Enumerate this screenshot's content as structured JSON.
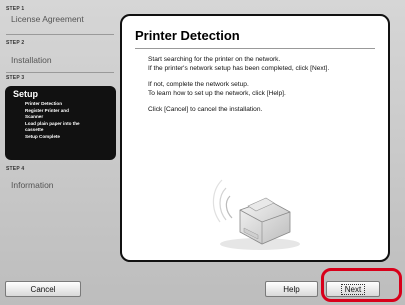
{
  "sidebar": {
    "steps": [
      {
        "step": "STEP 1",
        "name": "License Agreement"
      },
      {
        "step": "STEP 2",
        "name": "Installation"
      },
      {
        "step": "STEP 3",
        "name": "Setup"
      },
      {
        "step": "STEP 4",
        "name": "Information"
      }
    ],
    "setup_items": [
      "Printer Detection",
      "Register Printer and",
      "Scanner",
      "Load plain paper into the",
      "cassette",
      "Setup Complete"
    ]
  },
  "main": {
    "title": "Printer Detection",
    "paragraphs": [
      [
        "Start searching for the printer on the network.",
        "If the printer's network setup has been completed, click [Next]."
      ],
      [
        "If not, complete the network setup.",
        "To learn how to set up the network, click [Help]."
      ],
      [
        "Click [Cancel] to cancel the installation."
      ]
    ],
    "illustration": "printer-illustration"
  },
  "buttons": {
    "cancel": "Cancel",
    "help": "Help",
    "next": "Next"
  },
  "colors": {
    "highlight": "#d8001a",
    "active_step_bg": "#111111"
  }
}
